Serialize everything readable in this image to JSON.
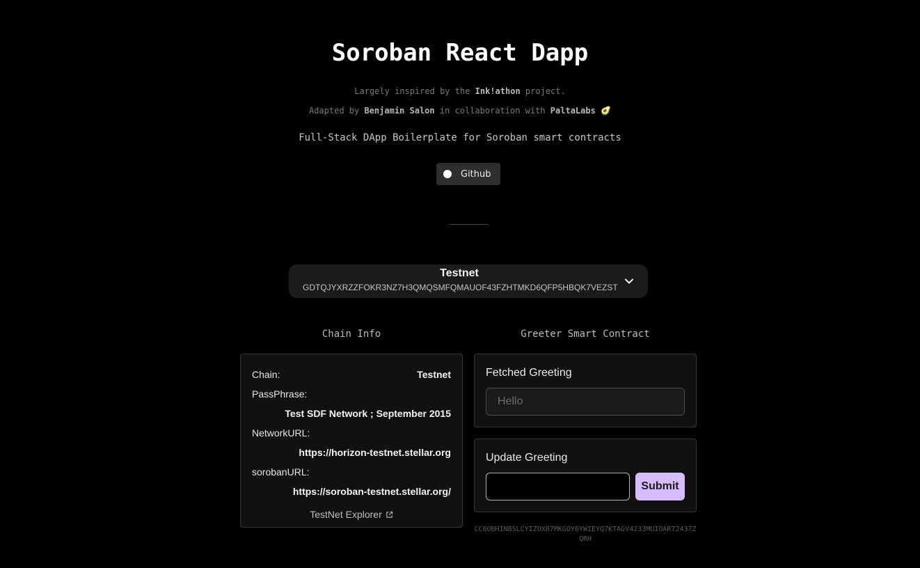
{
  "header": {
    "title": "Soroban React Dapp",
    "credit_1": {
      "prefix": "Largely inspired by the ",
      "project": "Ink!athon",
      "suffix": " project."
    },
    "credit_2": {
      "prefix": "Adapted by ",
      "author": "Benjamin Salon",
      "middle": " in collaboration with ",
      "partner": "PaltaLabs",
      "emoji": "🥑"
    },
    "tagline": "Full-Stack DApp Boilerplate for Soroban smart contracts",
    "github_label": "Github"
  },
  "account": {
    "network": "Testnet",
    "address": "GDTQJYXRZZFOKR3NZ7H3QMQSMFQMAUOF43FZHTMKD6QFP5HBQK7VEZST"
  },
  "chain_info": {
    "section_title": "Chain Info",
    "chain_label": "Chain:",
    "chain_value": "Testnet",
    "passphrase_label": "PassPhrase:",
    "passphrase_value": "Test SDF Network ; September 2015",
    "network_url_label": "NetworkURL:",
    "network_url_value": "https://horizon-testnet.stellar.org",
    "soroban_url_label": "sorobanURL:",
    "soroban_url_value": "https://soroban-testnet.stellar.org/",
    "explorer_label": "TestNet Explorer"
  },
  "greeter": {
    "section_title": "Greeter Smart Contract",
    "fetched_label": "Fetched Greeting",
    "fetched_placeholder": "Hello",
    "update_label": "Update Greeting",
    "update_value": "",
    "submit_label": "Submit",
    "contract_id": "CC6OBHINBSLCYIZOXB7MKGOY6YWIEYQ7KTAGV4233MUIOAR72437ZQRH"
  },
  "colors": {
    "background": "#000000",
    "submit_accent": "#d6bcfa",
    "card_background": "#111111"
  },
  "icons": {
    "github": "github-icon",
    "chevron": "chevron-down-icon",
    "external_link": "external-link-icon"
  }
}
